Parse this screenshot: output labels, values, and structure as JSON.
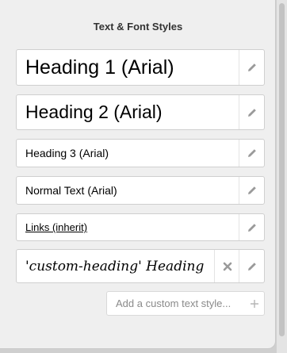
{
  "panel": {
    "title": "Text & Font Styles"
  },
  "styles": [
    {
      "label": "Heading 1 (Arial)",
      "edit_icon": "pencil-icon"
    },
    {
      "label": "Heading 2 (Arial)",
      "edit_icon": "pencil-icon"
    },
    {
      "label": "Heading 3 (Arial)",
      "edit_icon": "pencil-icon"
    },
    {
      "label": "Normal Text (Arial)",
      "edit_icon": "pencil-icon"
    },
    {
      "label": "Links (inherit)",
      "edit_icon": "pencil-icon"
    },
    {
      "label": "'custom-heading' Heading",
      "edit_icon": "pencil-icon",
      "delete_icon": "close-icon"
    }
  ],
  "add_custom": {
    "label": "Add a custom text style...",
    "icon": "plus-icon"
  },
  "colors": {
    "link": "#2a6bd1",
    "custom_heading": "#3bd33b"
  }
}
